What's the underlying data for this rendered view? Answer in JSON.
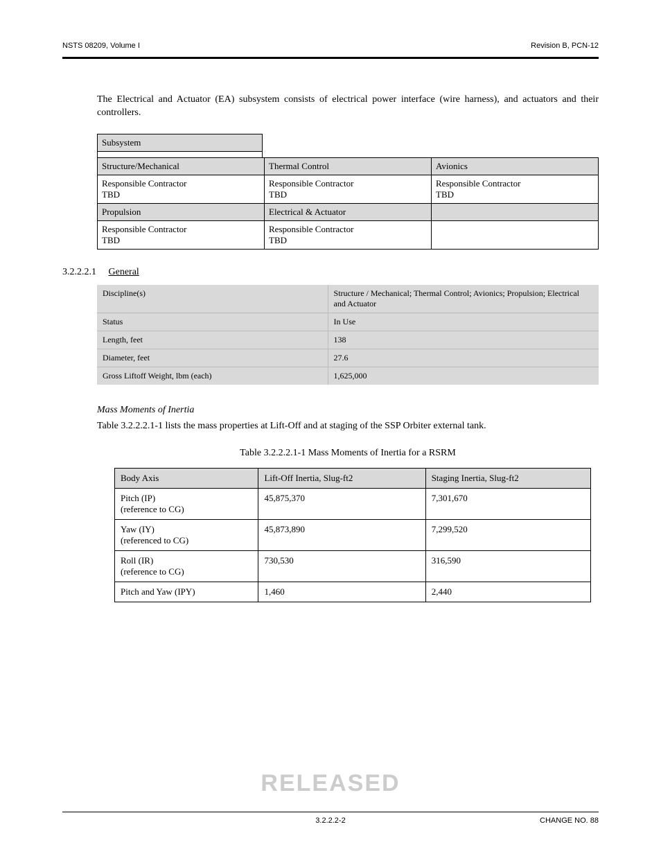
{
  "header": {
    "left": "NSTS 08209, Volume I",
    "right": "Revision B, PCN-12"
  },
  "intro": "The Electrical and Actuator (EA) subsystem consists of electrical power interface (wire harness), and actuators and their controllers.",
  "subsystem_table": {
    "header_row": {
      "c1": "Subsystem"
    },
    "blank_row": "",
    "cols": [
      "Structure/Mechanical",
      "Thermal Control",
      "Avionics"
    ],
    "row_contractor": {
      "c1": "Responsible Contractor",
      "c2": "TBD",
      "c3": "TBD"
    },
    "cols2": [
      "Propulsion",
      "Electrical & Actuator",
      ""
    ],
    "row_contractor2": {
      "c1": "Responsible Contractor",
      "c2": "TBD",
      "c3": ""
    }
  },
  "section_general": {
    "num": "3.2.2.2.1",
    "title": "General"
  },
  "general_table": [
    {
      "left": "Discipline(s)",
      "right": "Structure / Mechanical; Thermal Control; Avionics; Propulsion; Electrical and Actuator"
    },
    {
      "left": "Status",
      "right": "In Use"
    },
    {
      "left": "Length, feet",
      "right": "138"
    },
    {
      "left": "Diameter, feet",
      "right": "27.6"
    },
    {
      "left": "Gross Liftoff Weight, lbm (each)",
      "right": "1,625,000"
    }
  ],
  "mass_moments_title": "Mass Moments of Inertia",
  "mass_moments_text": "Table 3.2.2.2.1-1 lists the mass properties at Lift-Off and at staging of the SSP Orbiter external tank.",
  "table_caption": "Table 3.2.2.2.1-1 Mass Moments of Inertia for a RSRM",
  "inertia_table": {
    "headers": [
      "Body Axis",
      "Lift-Off Inertia, Slug-ft2",
      "Staging Inertia, Slug-ft2"
    ],
    "rows": [
      {
        "axis": "Pitch (IP)\n(reference to CG)",
        "liftoff": "45,875,370",
        "staging": "7,301,670"
      },
      {
        "axis": "Yaw (IY)\n(referenced to CG)",
        "liftoff": "45,873,890",
        "staging": "7,299,520"
      },
      {
        "axis": "Roll (IR)\n(reference to CG)",
        "liftoff": "730,530",
        "staging": "316,590"
      },
      {
        "axis": "Pitch and Yaw (IPY)",
        "liftoff": "1,460",
        "staging": "2,440"
      }
    ]
  },
  "stamp": "RELEASED",
  "footer": {
    "left": "",
    "center": "3.2.2.2-2",
    "right": "CHANGE NO. 88"
  }
}
